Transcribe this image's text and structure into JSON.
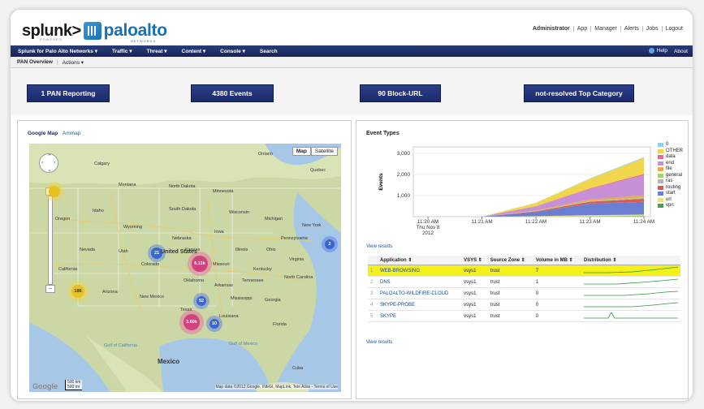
{
  "header": {
    "logo_splunk": "splunk>",
    "logo_splunk_sub": "POWERED",
    "logo_paloalto": "paloalto",
    "logo_paloalto_sub": "NETWORKS",
    "user": "Administrator",
    "links": [
      "App",
      "Manager",
      "Alerts",
      "Jobs",
      "Logout"
    ]
  },
  "appbar": {
    "items": [
      "Splunk for Palo Alto Networks ▾",
      "Traffic ▾",
      "Threat ▾",
      "Content ▾",
      "Console ▾",
      "Search"
    ],
    "help": "Help",
    "about": "About"
  },
  "viewbar": {
    "title": "PAN Overview",
    "actions": "Actions ▾"
  },
  "stats": [
    "1 PAN Reporting",
    "4380 Events",
    "90 Block-URL",
    "not-resolved Top Category"
  ],
  "map": {
    "tabs": {
      "active": "Google Map",
      "other": "Ammap"
    },
    "buttons": [
      "Map",
      "Satellite"
    ],
    "clusters": [
      {
        "label": "",
        "style": "yellow"
      },
      {
        "label": "21",
        "style": "blue"
      },
      {
        "label": "6.11k",
        "style": "pink"
      },
      {
        "label": "2",
        "style": "blue"
      },
      {
        "label": "186",
        "style": "yellow"
      },
      {
        "label": "52",
        "style": "blue"
      },
      {
        "label": "3.60k",
        "style": "pink"
      },
      {
        "label": "10",
        "style": "blue"
      }
    ],
    "labels": [
      "Ontario",
      "Calgary",
      "Quebec",
      "Montana",
      "North Dakota",
      "Minnesota",
      "Oregon",
      "Idaho",
      "South Dakota",
      "Wisconsin",
      "Michigan",
      "Wyoming",
      "Iowa",
      "New York",
      "Pennsylvania",
      "Nevada",
      "Nebraska",
      "Illinois",
      "Ohio",
      "Utah",
      "United States",
      "Colorado",
      "Kansas",
      "Missouri",
      "Kentucky",
      "Virginia",
      "California",
      "Tennessee",
      "North Carolina",
      "Arizona",
      "Oklahoma",
      "Arkansas",
      "New Mexico",
      "Mississippi",
      "Georgia",
      "Texas",
      "Louisiana",
      "Florida",
      "Gulf of Mexico",
      "Mexico",
      "Cuba",
      "Gulf of California"
    ],
    "google": "Google",
    "scale_km": "500 km",
    "scale_mi": "500 mi",
    "attribution": "Map data ©2012 Google, INEGI, MapLink, Tele Atlas - Terms of Use"
  },
  "events_panel": {
    "title": "Event Types",
    "view_results": "View results",
    "view_results_2": "View results"
  },
  "chart_data": {
    "type": "area",
    "title": "",
    "ylabel": "Events",
    "xlabel": "",
    "yticks": [
      "1,000",
      "2,000",
      "3,000"
    ],
    "ylim": [
      0,
      3300
    ],
    "x": [
      "11:20 AM Thu Nov 8 2012",
      "11:21 AM",
      "11:22 AM",
      "11:23 AM",
      "11:24 AM"
    ],
    "x_label_lines": [
      [
        "11:20 AM",
        "Thu Nov 8",
        "2012"
      ],
      [
        "11:21 AM"
      ],
      [
        "11:22 AM"
      ],
      [
        "11:23 AM"
      ],
      [
        "11:24 AM"
      ]
    ],
    "legend_placement": "right",
    "series": [
      {
        "name": "0",
        "color": "#8fcfe8",
        "values": [
          0,
          0,
          5,
          20,
          40
        ]
      },
      {
        "name": "OTHER",
        "color": "#f0d64a",
        "values": [
          0,
          0,
          150,
          450,
          750
        ]
      },
      {
        "name": "data",
        "color": "#e36b9b",
        "values": [
          0,
          0,
          10,
          30,
          60
        ]
      },
      {
        "name": "end",
        "color": "#c78fd6",
        "values": [
          0,
          0,
          200,
          500,
          950
        ]
      },
      {
        "name": "file",
        "color": "#f0a64a",
        "values": [
          0,
          0,
          20,
          60,
          90
        ]
      },
      {
        "name": "general",
        "color": "#a3d36b",
        "values": [
          0,
          0,
          10,
          30,
          50
        ]
      },
      {
        "name": "ras",
        "color": "#b5b5b5",
        "values": [
          0,
          0,
          5,
          10,
          20
        ]
      },
      {
        "name": "routing",
        "color": "#d85a5a",
        "values": [
          0,
          0,
          30,
          90,
          150
        ]
      },
      {
        "name": "start",
        "color": "#6a7fd1",
        "values": [
          0,
          0,
          200,
          550,
          600
        ]
      },
      {
        "name": "url",
        "color": "#e8e08a",
        "values": [
          0,
          0,
          20,
          60,
          80
        ]
      },
      {
        "name": "vpn",
        "color": "#4c9e4c",
        "values": [
          0,
          0,
          5,
          10,
          20
        ]
      }
    ]
  },
  "table": {
    "headers": [
      "Application ⇕",
      "VSYS ⇕",
      "Source Zone ⇕",
      "Volume in MB ⇕",
      "Distribution ⇕"
    ],
    "rows": [
      {
        "n": "1",
        "app": "WEB-BROWSING",
        "vsys": "vsys1",
        "zone": "trust",
        "vol": "7"
      },
      {
        "n": "2",
        "app": "DNS",
        "vsys": "vsys1",
        "zone": "trust",
        "vol": "1"
      },
      {
        "n": "3",
        "app": "PALOALTO-WILDFIRE-CLOUD",
        "vsys": "vsys1",
        "zone": "trust",
        "vol": "0"
      },
      {
        "n": "4",
        "app": "SKYPE-PROBE",
        "vsys": "vsys1",
        "zone": "trust",
        "vol": "0"
      },
      {
        "n": "5",
        "app": "SKYPE",
        "vsys": "vsys1",
        "zone": "trust",
        "vol": "0"
      }
    ]
  }
}
